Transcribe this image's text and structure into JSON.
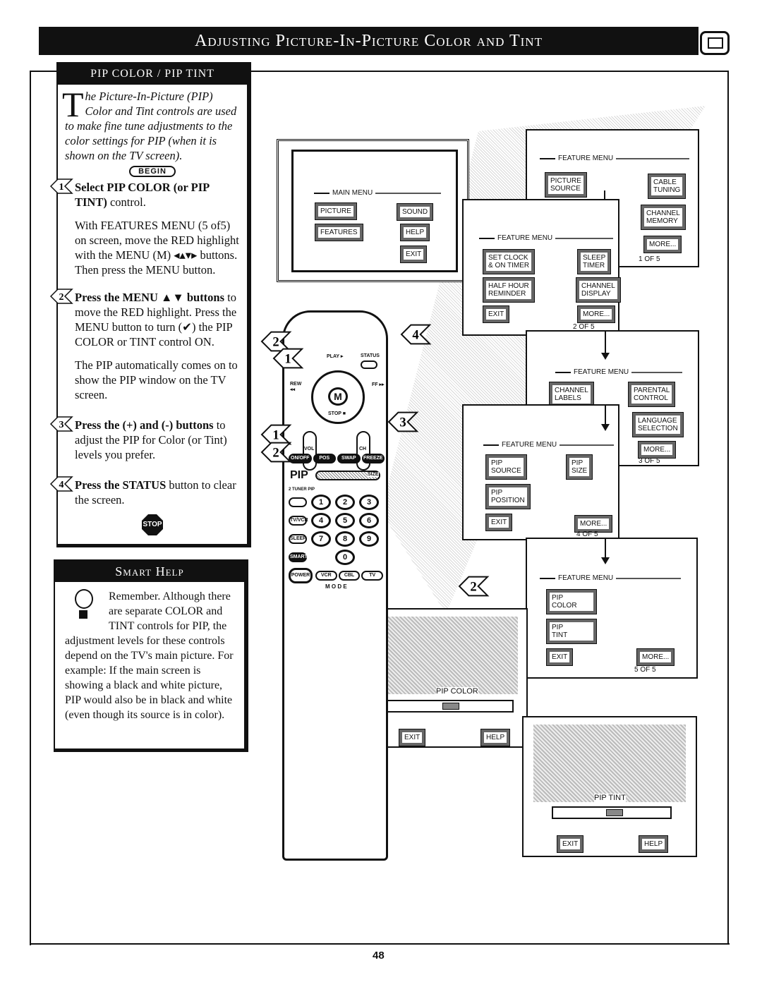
{
  "page": {
    "title": "Adjusting Picture-In-Picture Color and Tint",
    "page_number": "48",
    "icon": "tv-icon"
  },
  "instructions": {
    "heading": "PIP COLOR / PIP TINT",
    "intro_dropcap": "T",
    "intro": "he Picture-In-Picture (PIP) Color and Tint controls are used to make fine tune adjustments to the color settings for PIP (when it is shown on the TV screen).",
    "begin_label": "BEGIN",
    "steps": [
      {
        "num": "1",
        "bold": "Select PIP COLOR (or PIP TINT)",
        "text": " control.",
        "extra": "With FEATURES MENU (5 of5) on screen, move the RED highlight with the MENU (M) ◂▴▾▸ buttons. Then press the MENU button."
      },
      {
        "num": "2",
        "bold": "Press the MENU ▲▼ buttons",
        "text": " to move the RED highlight. Press the MENU button to turn (✔) the PIP COLOR or TINT control ON.",
        "extra": "The PIP automatically comes on to show the PIP window on the TV screen."
      },
      {
        "num": "3",
        "bold": "Press the (+) and (-) buttons",
        "text": " to adjust the PIP for Color (or Tint) levels you prefer.",
        "extra": ""
      },
      {
        "num": "4",
        "bold": "Press the STATUS",
        "text": " button to clear the screen.",
        "extra": ""
      }
    ],
    "stop_label": "STOP"
  },
  "smart_help": {
    "heading": "Smart Help",
    "text": "Remember. Although there are separate COLOR and TINT controls for PIP, the adjustment levels for these controls depend on the TV's main picture. For example: If the main screen is showing a black and white picture, PIP would also be in black and white (even though its source is in color)."
  },
  "screens": {
    "main_menu": {
      "title": "MAIN MENU",
      "items": [
        "PICTURE",
        "FEATURES",
        "SOUND",
        "HELP",
        "EXIT"
      ]
    },
    "feature1": {
      "title": "FEATURE MENU",
      "items": [
        "PICTURE\nSOURCE",
        "CABLE\nTUNING",
        "CHANNEL\nMEMORY",
        "MORE..."
      ],
      "page": "1 OF 5"
    },
    "feature2": {
      "title": "FEATURE MENU",
      "items": [
        "SET CLOCK\n& ON TIMER",
        "SLEEP\nTIMER",
        "HALF HOUR\nREMINDER",
        "CHANNEL\nDISPLAY",
        "EXIT",
        "MORE..."
      ],
      "page": "2 OF 5"
    },
    "feature3": {
      "title": "FEATURE MENU",
      "items": [
        "CHANNEL\nLABELS",
        "PARENTAL\nCONTROL",
        "LANGUAGE\nSELECTION",
        "MORE..."
      ],
      "page": "3 OF 5"
    },
    "feature4": {
      "title": "FEATURE MENU",
      "items": [
        "PIP\nSOURCE",
        "PIP\nSIZE",
        "PIP\nPOSITION",
        "EXIT",
        "MORE..."
      ],
      "page": "4 OF 5"
    },
    "feature5": {
      "title": "FEATURE MENU",
      "items": [
        "PIP\nCOLOR",
        "PIP\nTINT",
        "EXIT",
        "MORE..."
      ],
      "page": "5 OF 5"
    },
    "pip_color": {
      "label": "PIP COLOR",
      "exit": "EXIT",
      "help": "HELP"
    },
    "pip_tint": {
      "label": "PIP TINT",
      "exit": "EXIT",
      "help": "HELP"
    }
  },
  "remote": {
    "labels": {
      "play": "PLAY ▸",
      "status": "STATUS",
      "rew": "REW ◂◂",
      "ff": "FF ▸▸",
      "menu": "M",
      "stop": "STOP ■",
      "vol": "VOL",
      "ch": "CH",
      "pip": "PIP",
      "size": "SIZE",
      "tuner": "2 TUNER PIP",
      "tvvcr": "TV/VCR",
      "sleep": "SLEEP",
      "smart": "SMART",
      "power": "POWER",
      "mode": "M O D E"
    },
    "pip_keys": [
      "ON/OFF",
      "POS",
      "SWAP",
      "FREEZE"
    ],
    "numbers": [
      "1",
      "2",
      "3",
      "4",
      "5",
      "6",
      "7",
      "8",
      "9",
      "0"
    ],
    "mode_keys": [
      "VCR",
      "CBL",
      "TV"
    ],
    "callouts": [
      "2",
      "1",
      "4",
      "3",
      "1",
      "2"
    ]
  }
}
